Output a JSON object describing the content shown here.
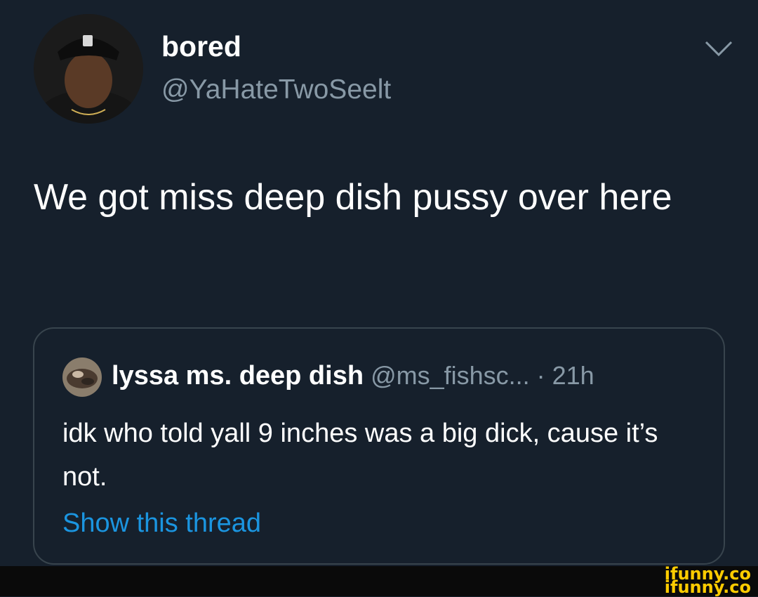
{
  "tweet": {
    "display_name": "bored",
    "handle": "@YaHateTwoSeelt",
    "text": "We got miss deep dish pussy over here",
    "icons": {
      "avatar": "profile-photo",
      "caret": "chevron-down-icon"
    }
  },
  "quoted_tweet": {
    "display_name": "lyssa ms. deep dish",
    "meta": "@ms_fishsc... · 21h",
    "text": "idk who told yall 9 inches was a big dick, cause it’s not.",
    "show_thread_label": "Show this thread"
  },
  "watermark": {
    "line1": "ifunny.co",
    "line2": "ifunny.co"
  },
  "colors": {
    "background": "#15202b",
    "secondary_text": "#8899a6",
    "link": "#1b95e0",
    "border": "#38444d",
    "watermark": "#ffcc00"
  }
}
